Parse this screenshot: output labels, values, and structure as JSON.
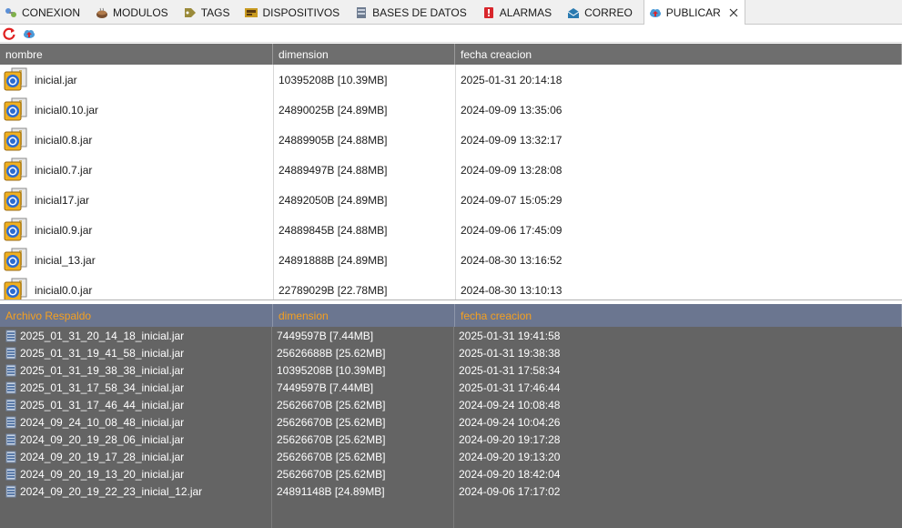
{
  "tabs": [
    {
      "label": "CONEXION",
      "icon": "plug-icon"
    },
    {
      "label": "MODULOS",
      "icon": "coffee-icon"
    },
    {
      "label": "TAGS",
      "icon": "tag-icon"
    },
    {
      "label": "DISPOSITIVOS",
      "icon": "devices-icon"
    },
    {
      "label": "BASES DE DATOS",
      "icon": "database-icon"
    },
    {
      "label": "ALARMAS",
      "icon": "alarm-icon"
    },
    {
      "label": "CORREO",
      "icon": "mail-icon"
    },
    {
      "label": "PUBLICAR",
      "icon": "cloud-upload-icon",
      "active": true
    }
  ],
  "toolbar": {
    "refresh_icon": "refresh-icon",
    "publish_icon": "cloud-upload-icon"
  },
  "files": {
    "headers": [
      "nombre",
      "dimension",
      "fecha creacion"
    ],
    "rows": [
      {
        "name": "inicial.jar",
        "size": "10395208B [10.39MB]",
        "date": "2025-01-31 20:14:18"
      },
      {
        "name": "inicial0.10.jar",
        "size": "24890025B [24.89MB]",
        "date": "2024-09-09 13:35:06"
      },
      {
        "name": "inicial0.8.jar",
        "size": "24889905B [24.88MB]",
        "date": "2024-09-09 13:32:17"
      },
      {
        "name": "inicial0.7.jar",
        "size": "24889497B [24.88MB]",
        "date": "2024-09-09 13:28:08"
      },
      {
        "name": "inicial17.jar",
        "size": "24892050B [24.89MB]",
        "date": "2024-09-07 15:05:29"
      },
      {
        "name": "inicial0.9.jar",
        "size": "24889845B [24.88MB]",
        "date": "2024-09-06 17:45:09"
      },
      {
        "name": "inicial_13.jar",
        "size": "24891888B [24.89MB]",
        "date": "2024-08-30 13:16:52"
      },
      {
        "name": "inicial0.0.jar",
        "size": "22789029B [22.78MB]",
        "date": "2024-08-30 13:10:13"
      }
    ]
  },
  "backups": {
    "headers": [
      "Archivo Respaldo",
      "dimension",
      "fecha creacion"
    ],
    "rows": [
      {
        "name": "2025_01_31_20_14_18_inicial.jar",
        "size": "7449597B [7.44MB]",
        "date": "2025-01-31 19:41:58"
      },
      {
        "name": "2025_01_31_19_41_58_inicial.jar",
        "size": "25626688B [25.62MB]",
        "date": "2025-01-31 19:38:38"
      },
      {
        "name": "2025_01_31_19_38_38_inicial.jar",
        "size": "10395208B [10.39MB]",
        "date": "2025-01-31 17:58:34"
      },
      {
        "name": "2025_01_31_17_58_34_inicial.jar",
        "size": "7449597B [7.44MB]",
        "date": "2025-01-31 17:46:44"
      },
      {
        "name": "2025_01_31_17_46_44_inicial.jar",
        "size": "25626670B [25.62MB]",
        "date": "2024-09-24 10:08:48"
      },
      {
        "name": "2024_09_24_10_08_48_inicial.jar",
        "size": "25626670B [25.62MB]",
        "date": "2024-09-24 10:04:26"
      },
      {
        "name": "2024_09_20_19_28_06_inicial.jar",
        "size": "25626670B [25.62MB]",
        "date": "2024-09-20 19:17:28"
      },
      {
        "name": "2024_09_20_19_17_28_inicial.jar",
        "size": "25626670B [25.62MB]",
        "date": "2024-09-20 19:13:20"
      },
      {
        "name": "2024_09_20_19_13_20_inicial.jar",
        "size": "25626670B [25.62MB]",
        "date": "2024-09-20 18:42:04"
      },
      {
        "name": "2024_09_20_19_22_23_inicial_12.jar",
        "size": "24891148B [24.89MB]",
        "date": "2024-09-06 17:17:02"
      }
    ]
  },
  "colors": {
    "backup_header_bg": "#6b7690",
    "backup_header_text": "#f5a020",
    "backup_body_bg": "#646464",
    "file_header_bg": "#6e6e6e"
  }
}
